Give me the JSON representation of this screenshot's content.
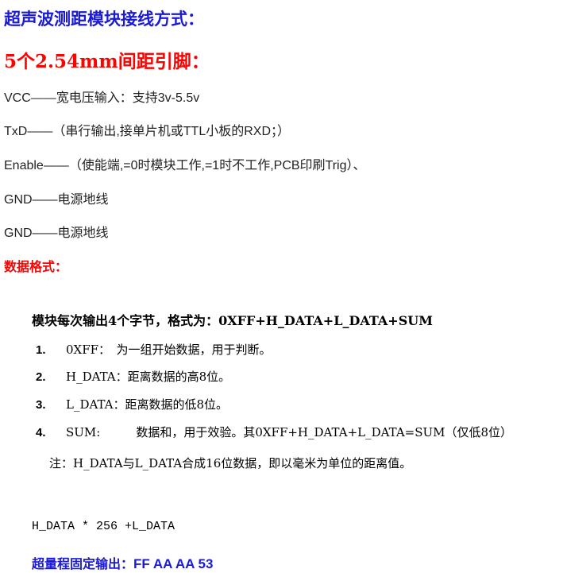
{
  "heading": "超声波测距模块接线方式：",
  "subheading": "5个2.54mm间距引脚：",
  "pins": [
    "VCC——宽电压输入：支持3v-5.5v",
    "TxD——（串行输出,接单片机或TTL小板的RXD；）",
    "Enable——（使能端,=0时模块工作,=1时不工作,PCB印刷Trig）、",
    "GND——电源地线",
    "GND——电源地线"
  ],
  "data_format_heading": "数据格式：",
  "format_title": "模块每次输出4个字节，格式为：0XFF+H_DATA+L_DATA+SUM",
  "items": [
    {
      "num": "1.",
      "text": "0XFF：　为一组开始数据，用于判断。"
    },
    {
      "num": "2.",
      "text": "H_DATA：距离数据的高8位。"
    },
    {
      "num": "3.",
      "text": "L_DATA：距离数据的低8位。"
    },
    {
      "num": "4.",
      "text": "SUM:　　　数据和，用于效验。其0XFF+H_DATA+L_DATA=SUM（仅低8位）"
    }
  ],
  "note": "注：H_DATA与L_DATA合成16位数据，即以毫米为单位的距离值。",
  "formula": "H_DATA * 256 +L_DATA",
  "overrange_label": "超量程固定输出：",
  "overrange_value": "FF AA AA 53",
  "colors": {
    "heading": "#1a1ad6",
    "subheading": "#ff0000",
    "data_format_heading": "#ff0000",
    "overrange": "#1a1ad6"
  }
}
